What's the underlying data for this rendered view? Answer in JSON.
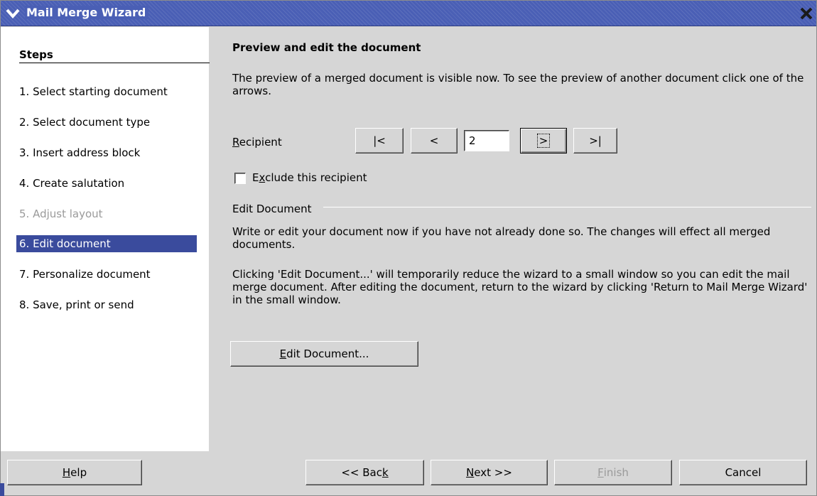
{
  "window": {
    "title": "Mail Merge Wizard",
    "menu_icon": "chevron-down-icon",
    "close_icon": "close-icon",
    "accent_color": "#3a4b9d"
  },
  "steps": {
    "header": "Steps",
    "items": [
      {
        "label": "1. Select starting document",
        "state": "normal"
      },
      {
        "label": "2. Select document type",
        "state": "normal"
      },
      {
        "label": "3. Insert address block",
        "state": "normal"
      },
      {
        "label": "4. Create salutation",
        "state": "normal"
      },
      {
        "label": "5. Adjust layout",
        "state": "disabled"
      },
      {
        "label": "6. Edit document",
        "state": "active"
      },
      {
        "label": "7. Personalize document",
        "state": "normal"
      },
      {
        "label": "8. Save, print or send",
        "state": "normal"
      }
    ]
  },
  "main": {
    "heading": "Preview and edit the document",
    "intro": "The preview of a merged document is visible now. To see the preview of another document click one of the arrows.",
    "recipient": {
      "label_accel": "R",
      "label_rest": "ecipient",
      "first_label": "|<",
      "prev_label": "<",
      "value": "2",
      "next_label": ">",
      "last_label": ">|"
    },
    "exclude": {
      "label_pre": "E",
      "label_accel": "x",
      "label_rest": "clude this recipient",
      "checked": false
    },
    "edit_group": {
      "title": "Edit Document",
      "para1": "Write or edit your document now if you have not already done so. The changes will effect all merged documents.",
      "para2": "Clicking 'Edit Document...' will temporarily reduce the wizard to a small window so you can edit the mail merge document. After editing the document, return to the wizard by clicking 'Return to Mail Merge Wizard' in the small window.",
      "button_accel": "E",
      "button_rest": "dit Document..."
    }
  },
  "footer": {
    "help_accel": "H",
    "help_rest": "elp",
    "back_pre": "<< Bac",
    "back_accel": "k",
    "next_accel": "N",
    "next_rest": "ext >>",
    "finish_accel": "F",
    "finish_rest": "inish",
    "cancel": "Cancel"
  }
}
